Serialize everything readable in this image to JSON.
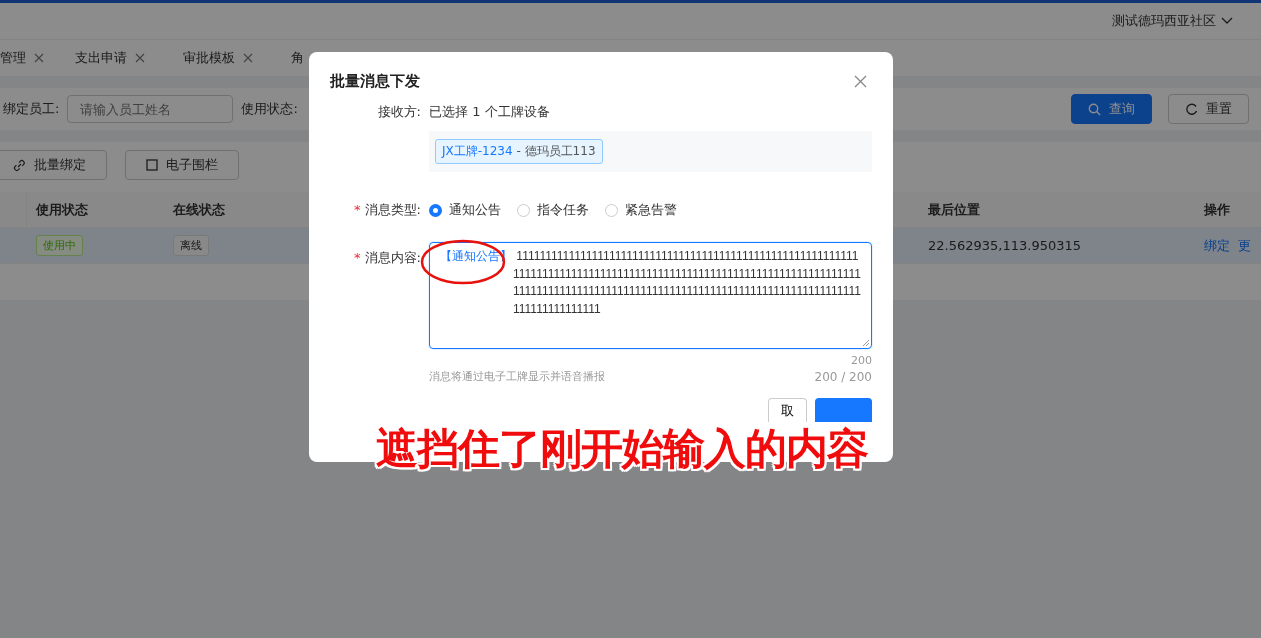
{
  "header": {
    "community": "测试德玛西亚社区"
  },
  "tabs": [
    {
      "label": "管理",
      "closable": true
    },
    {
      "label": "支出申请",
      "closable": true
    },
    {
      "label": "审批模板",
      "closable": true
    },
    {
      "label": "角",
      "closable": false
    }
  ],
  "filters": {
    "employee_label": "绑定员工:",
    "employee_placeholder": "请输入员工姓名",
    "status_label": "使用状态:",
    "search_button": "查询",
    "reset_button": "重置"
  },
  "toolbar": [
    {
      "label": "批量绑定",
      "kind": "link"
    },
    {
      "label": "电子围栏",
      "kind": "square"
    }
  ],
  "table": {
    "columns": [
      {
        "label": "使用状态",
        "kind": "usage"
      },
      {
        "label": "在线状态",
        "kind": "online"
      },
      {
        "label": "最后位置",
        "kind": "location"
      },
      {
        "label": "操作",
        "kind": "actions"
      }
    ],
    "rows": [
      {
        "usage": "使用中",
        "online": "离线",
        "location": "22.562935,113.950315",
        "actions": [
          "绑定",
          "更"
        ],
        "selected": true
      }
    ]
  },
  "dialog": {
    "title": "批量消息下发",
    "recipient": {
      "label": "接收方:",
      "summary": "已选择 1 个工牌设备",
      "tags": [
        {
          "device": "JX工牌-1234",
          "employee": "- 德玛员工113"
        }
      ]
    },
    "type": {
      "marker": "*",
      "label": "消息类型:",
      "options": [
        {
          "label": "通知公告",
          "selected": true
        },
        {
          "label": "指令任务",
          "selected": false
        },
        {
          "label": "紧急告警",
          "selected": false
        }
      ]
    },
    "content": {
      "marker": "*",
      "label": "消息内容:",
      "prefix": "【通知公告】",
      "value": "11111111111111111111111111111111111111111111111111111111111111111111111111111111111111111111111111111111111111111111111111111111111111111111111111111111111111111111111111111111111111111111111111",
      "max": "200",
      "hint": "消息将通过电子工牌显示并语音播报",
      "counter": "200 / 200"
    },
    "buttons": [
      {
        "label": "取",
        "kind": "default"
      },
      {
        "kind": "primary"
      }
    ]
  },
  "annotation": {
    "text": "遮挡住了刚开始输入的内容"
  }
}
